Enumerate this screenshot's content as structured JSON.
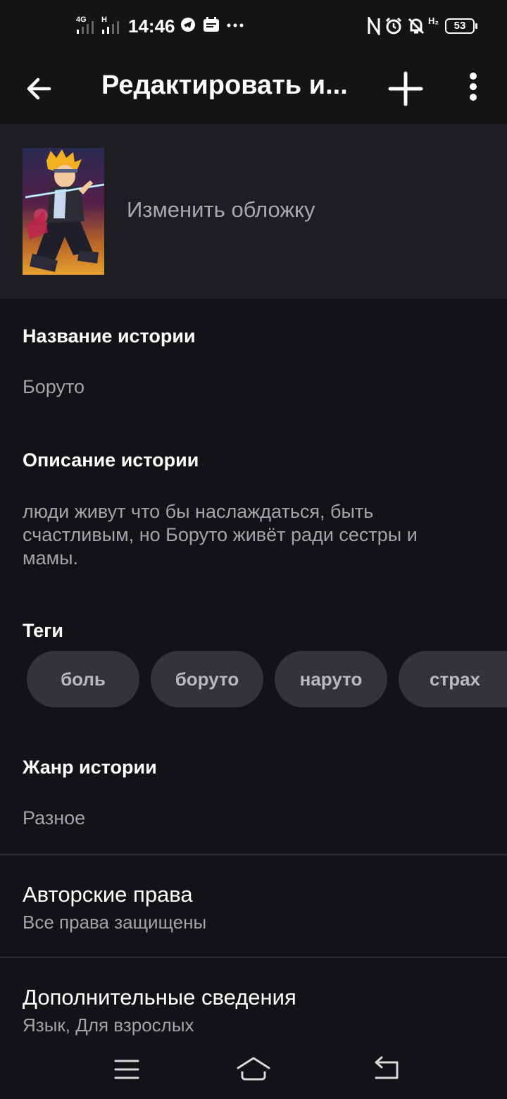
{
  "status_bar": {
    "network_1": "4G",
    "network_2": "H",
    "time": "14:46",
    "battery": "53",
    "extra_indicator": "H₂",
    "icons": [
      "signal-icon",
      "telegram-icon",
      "calendar-icon",
      "more-dots-icon",
      "nfc-icon",
      "alarm-icon",
      "bell-off-icon",
      "battery-icon"
    ]
  },
  "app_bar": {
    "title": "Редактировать и...",
    "icons": [
      "back-arrow-icon",
      "plus-icon",
      "more-vertical-icon"
    ]
  },
  "cover": {
    "label": "Изменить обложку"
  },
  "story": {
    "title_label": "Название истории",
    "title_value": "Боруто",
    "description_label": "Описание истории",
    "description_value": "люди живут что бы наслаждаться, быть счастливым, но Боруто живёт ради сестры и мамы.",
    "tags_label": "Теги",
    "tags": [
      "боль",
      "боруто",
      "наруто",
      "страх"
    ],
    "genre_label": "Жанр истории",
    "genre_value": "Разное"
  },
  "copyright": {
    "title": "Авторские права",
    "subtitle": "Все права защищены"
  },
  "additional": {
    "title": "Дополнительные сведения",
    "subtitle": "Язык, Для взрослых"
  },
  "nav_bar": {
    "icons": [
      "menu-icon",
      "home-icon",
      "back-icon"
    ]
  },
  "colors": {
    "background": "#141216",
    "cover_section": "#1e1d21",
    "tag_background": "#343338",
    "secondary_text": "#a4a3a6"
  }
}
